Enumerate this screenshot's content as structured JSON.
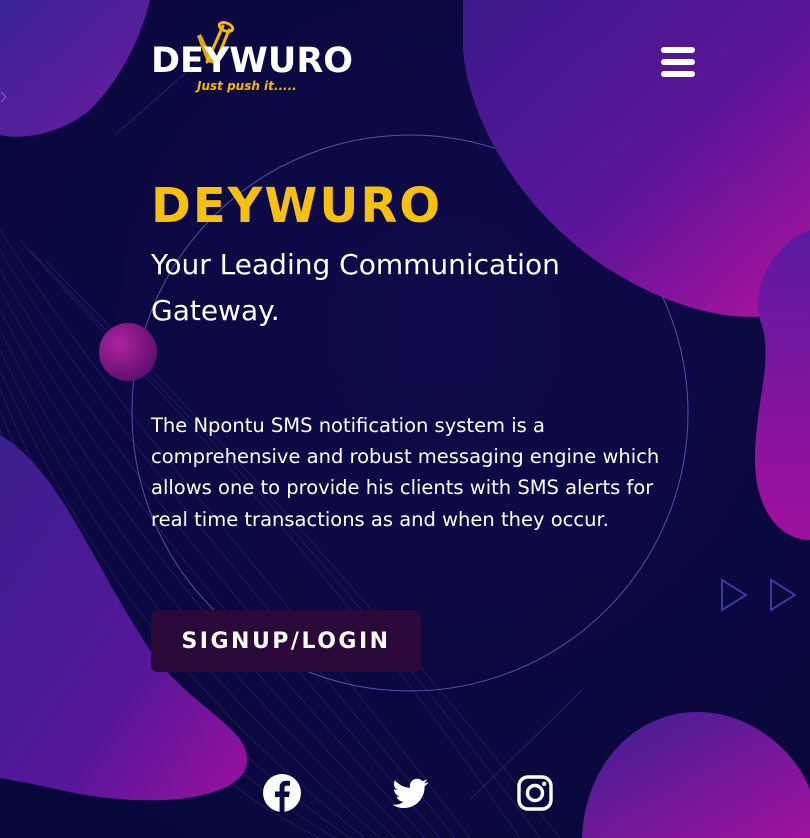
{
  "header": {
    "logo": {
      "wordmark": "DEYWURO",
      "tagline": "Just push it....."
    },
    "menu_icon": "hamburger-menu-icon"
  },
  "hero": {
    "title": "DEYWURO",
    "subtitle": "Your Leading Communication Gateway.",
    "description": "The Npontu SMS notification system is a comprehensive and robust messaging engine which allows one to provide his clients with SMS alerts for real time transactions as and when they occur.",
    "cta_label": "SIGNUP/LOGIN"
  },
  "social": [
    {
      "icon": "facebook-icon"
    },
    {
      "icon": "twitter-icon"
    },
    {
      "icon": "instagram-icon"
    }
  ],
  "colors": {
    "background": "#0d0b45",
    "accent_yellow": "#f6c10e",
    "tagline_yellow": "#f5b800",
    "blob_purple": "#5a1a9a",
    "blob_magenta": "#b012a8",
    "cta_background": "#2a0838",
    "text": "#ffffff"
  }
}
